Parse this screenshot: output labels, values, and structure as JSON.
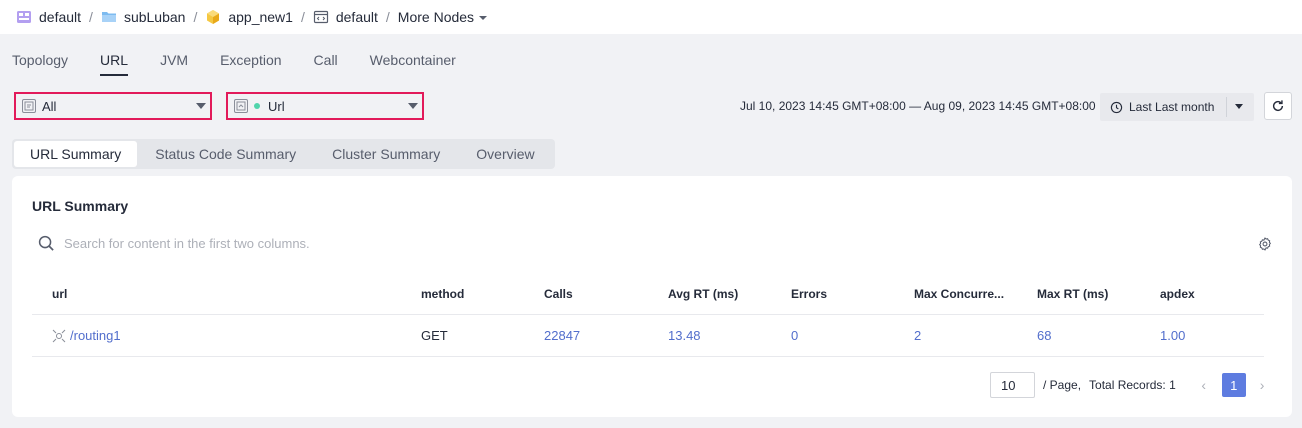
{
  "breadcrumb": {
    "items": [
      {
        "label": "default",
        "icon": "workspace-icon"
      },
      {
        "label": "subLuban",
        "icon": "folder-icon"
      },
      {
        "label": "app_new1",
        "icon": "app-cube-icon"
      },
      {
        "label": "default",
        "icon": "environment-icon"
      }
    ],
    "separator": "/",
    "more_nodes": "More Nodes"
  },
  "main_tabs": [
    "Topology",
    "URL",
    "JVM",
    "Exception",
    "Call",
    "Webcontainer"
  ],
  "active_main_tab": "URL",
  "filters": {
    "instance_select": "All",
    "type_select": "Url"
  },
  "time_range": {
    "text": "Jul 10, 2023 14:45 GMT+08:00 — Aug 09, 2023 14:45 GMT+08:00",
    "button_label": "Last Last month"
  },
  "sub_tabs": [
    "URL Summary",
    "Status Code Summary",
    "Cluster Summary",
    "Overview"
  ],
  "active_sub_tab": "URL Summary",
  "card": {
    "title": "URL Summary",
    "search_placeholder": "Search for content in the first two columns."
  },
  "table": {
    "columns": [
      "url",
      "method",
      "Calls",
      "Avg RT (ms)",
      "Errors",
      "Max Concurre...",
      "Max RT (ms)",
      "apdex"
    ],
    "rows": [
      {
        "url": "/routing1",
        "method": "GET",
        "calls": "22847",
        "avg_rt": "13.48",
        "errors": "0",
        "max_concurrency": "2",
        "max_rt": "68",
        "apdex": "1.00"
      }
    ]
  },
  "pagination": {
    "page_size": "10",
    "page_label": "/ Page,",
    "total_label": "Total Records: 1",
    "current_page": "1"
  },
  "colors": {
    "accent": "#5e7ce0",
    "link": "#526ecc",
    "highlight_border": "#e21a5a",
    "status_dot": "#50d4ab"
  }
}
